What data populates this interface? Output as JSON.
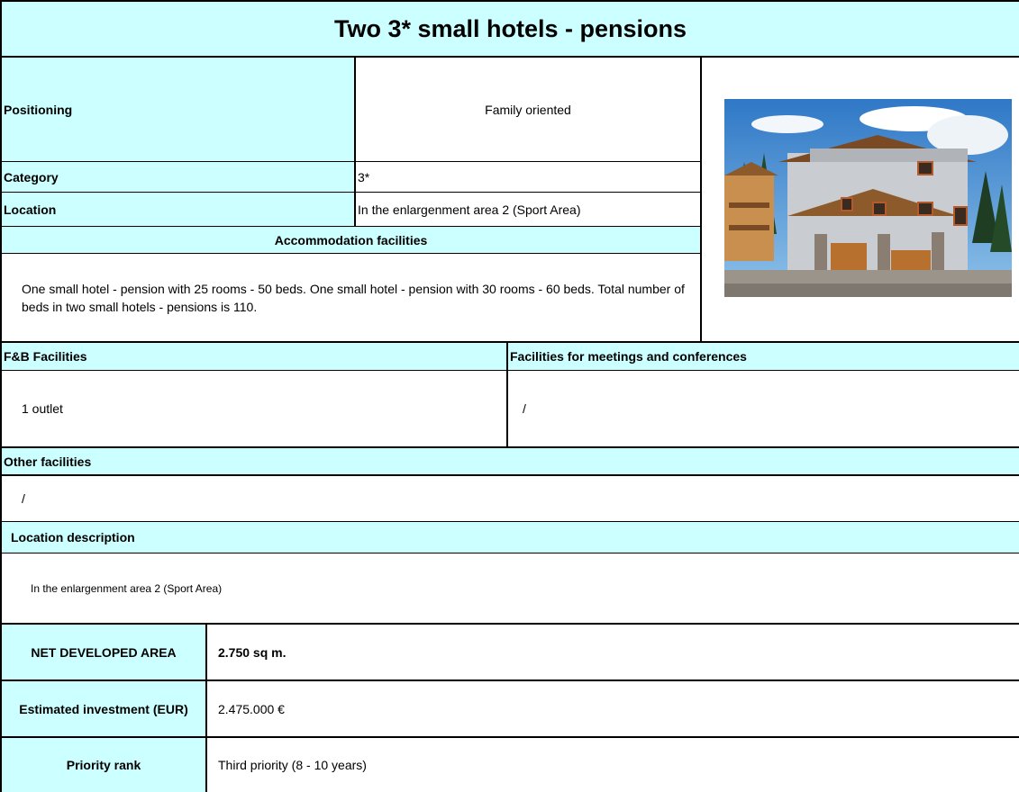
{
  "title": "Two 3* small hotels - pensions",
  "positioning": {
    "label": "Positioning",
    "value": "Family oriented"
  },
  "category": {
    "label": "Category",
    "value": "3*"
  },
  "location": {
    "label": "Location",
    "value": "In the enlargenment area 2 (Sport Area)"
  },
  "accommodation": {
    "header": "Accommodation facilities",
    "text": "One small hotel - pension with 25 rooms - 50 beds. One small hotel - pension with 30 rooms - 60 beds. Total number of beds in two small hotels - pensions is 110."
  },
  "photo": {
    "description": "hotel-photo"
  },
  "fb": {
    "header": "F&B Facilities",
    "value": "1 outlet"
  },
  "meetings": {
    "header": "Facilities for meetings and conferences",
    "value": "/"
  },
  "other": {
    "header": "Other facilities",
    "value": "/"
  },
  "location_description": {
    "header": "Location description",
    "value": "In the enlargenment area 2 (Sport Area)"
  },
  "summary": {
    "net_area": {
      "label": "NET DEVELOPED AREA",
      "value": "2.750 sq m."
    },
    "investment": {
      "label": "Estimated investment (EUR)",
      "value": "2.475.000 €"
    },
    "priority": {
      "label": "Priority rank",
      "value": "Third priority (8 - 10 years)"
    }
  },
  "colors": {
    "header_bg": "#ccffff",
    "border": "#000000"
  }
}
